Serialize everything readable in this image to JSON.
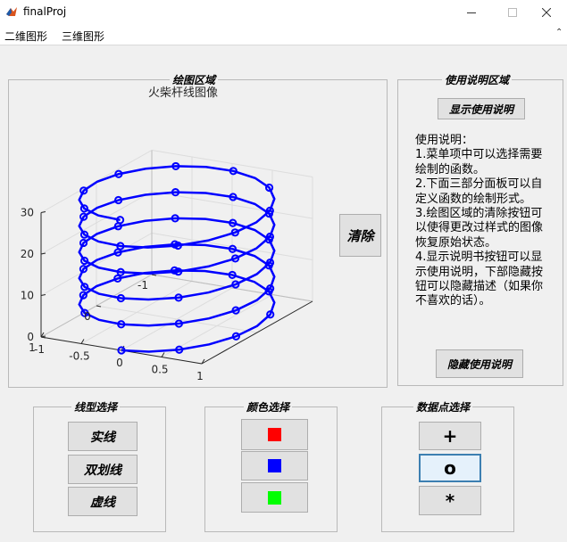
{
  "window": {
    "title": "finalProj",
    "minimize_icon": "minimize-icon",
    "maximize_icon": "maximize-icon",
    "close_icon": "close-icon"
  },
  "menu": {
    "items": [
      "二维图形",
      "三维图形"
    ]
  },
  "plot_panel": {
    "title": "绘图区域"
  },
  "chart_data": {
    "type": "3d-stem-helix",
    "title": "火柴杆线图像",
    "xlabel": "",
    "ylabel": "",
    "zlabel": "",
    "x_ticks": [
      -1,
      -0.5,
      0,
      0.5,
      1
    ],
    "y_ticks": [
      -1,
      0,
      1
    ],
    "z_ticks": [
      0,
      10,
      20,
      30
    ],
    "xlim": [
      -1,
      1
    ],
    "ylim": [
      -1,
      1
    ],
    "zlim": [
      0,
      30
    ],
    "series": [
      {
        "function": "x=sin(t), y=cos(t), z=t",
        "t_range": [
          0,
          31.4
        ],
        "marker": "o",
        "line": "solid",
        "color": "#0000ff",
        "points": 101
      }
    ]
  },
  "clear_button": {
    "label": "清除"
  },
  "help_panel": {
    "title": "使用说明区域",
    "show_label": "显示使用说明",
    "hide_label": "隐藏使用说明",
    "text": "使用说明：\n1.菜单项中可以选择需要绘制的函数。\n2.下面三部分面板可以自定义函数的绘制形式。\n3.绘图区域的清除按钮可以使得更改过样式的图像恢复原始状态。\n4.显示说明书按钮可以显示使用说明，下部隐藏按钮可以隐藏描述（如果你不喜欢的话）。"
  },
  "line_panel": {
    "title": "线型选择",
    "buttons": [
      "实线",
      "双划线",
      "虚线"
    ]
  },
  "color_panel": {
    "title": "颜色选择",
    "colors": [
      "#ff0000",
      "#0000ff",
      "#00ff00"
    ]
  },
  "marker_panel": {
    "title": "数据点选择",
    "buttons": [
      "+",
      "o",
      "*"
    ]
  }
}
